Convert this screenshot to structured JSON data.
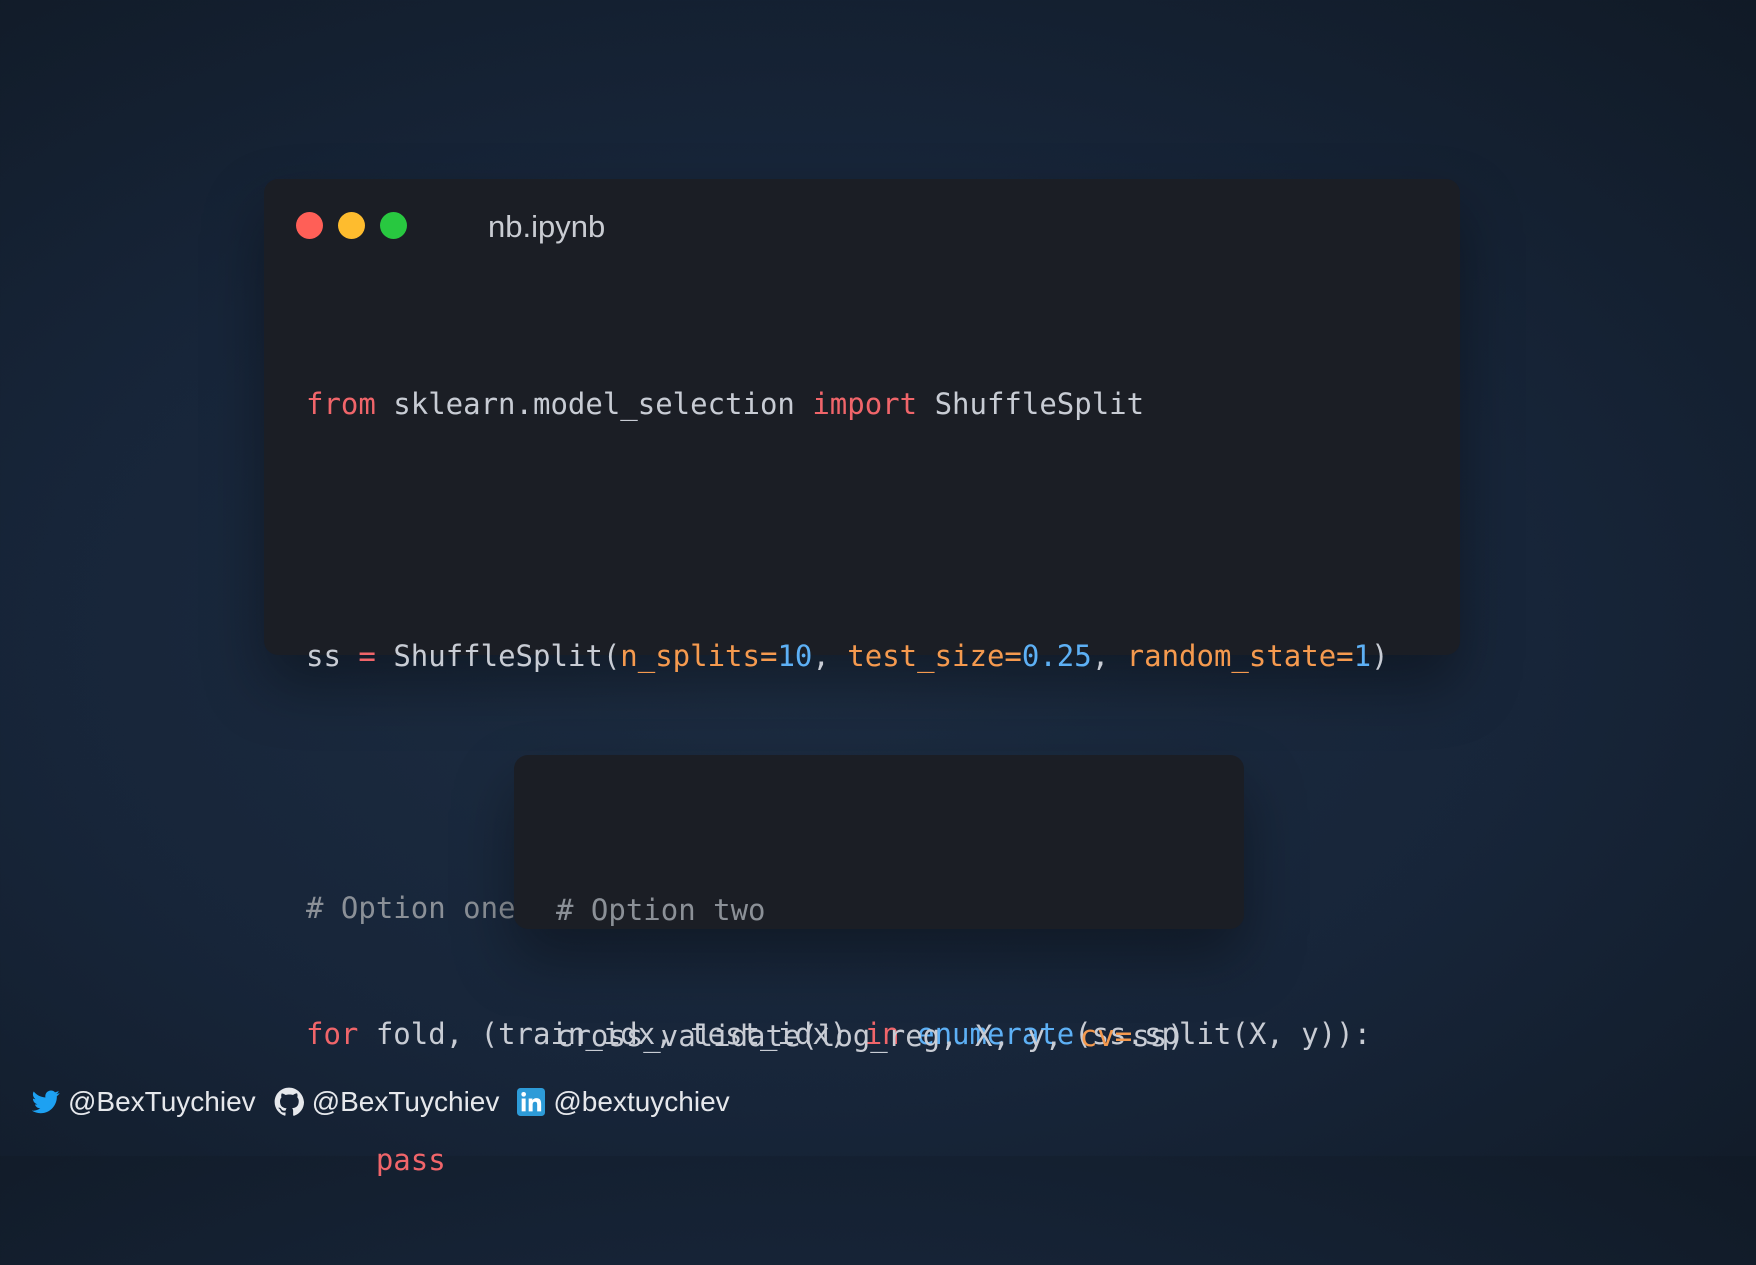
{
  "window": {
    "title": "nb.ipynb",
    "traffic_lights": [
      "close",
      "minimize",
      "maximize"
    ]
  },
  "code_main": {
    "line1": {
      "kw_from": "from",
      "module": " sklearn.model_selection ",
      "kw_import": "import",
      "name": " ShuffleSplit"
    },
    "line3": {
      "var": "ss ",
      "eq": "=",
      "call": " ShuffleSplit(",
      "arg1": "n_splits=",
      "val1": "10",
      "sep1": ", ",
      "arg2": "test_size=",
      "val2": "0.25",
      "sep2": ", ",
      "arg3": "random_state=",
      "val3": "1",
      "close": ")"
    },
    "line5": {
      "comment": "# Option one"
    },
    "line6": {
      "kw_for": "for",
      "mid": " fold, (train_idx, test_idx) ",
      "kw_in": "in",
      "sp": " ",
      "fn": "enumerate",
      "rest": "(ss.split(X, y)):"
    },
    "line7": {
      "indent": "    ",
      "kw_pass": "pass"
    }
  },
  "code_two": {
    "line1": {
      "comment": "# Option two"
    },
    "line2": {
      "call": "cross_validate(log_reg, X, y, ",
      "arg": "cv=",
      "val": "ss)"
    }
  },
  "footer": {
    "twitter_handle": "@BexTuychiev",
    "github_handle": "@BexTuychiev",
    "linkedin_handle": "@bextuychiev"
  },
  "colors": {
    "keyword": "#f0656a",
    "argument": "#f59a4f",
    "number": "#5db0f5",
    "comment": "#8b9097",
    "twitter": "#1da1f2",
    "linkedin": "#2d9bd8"
  }
}
